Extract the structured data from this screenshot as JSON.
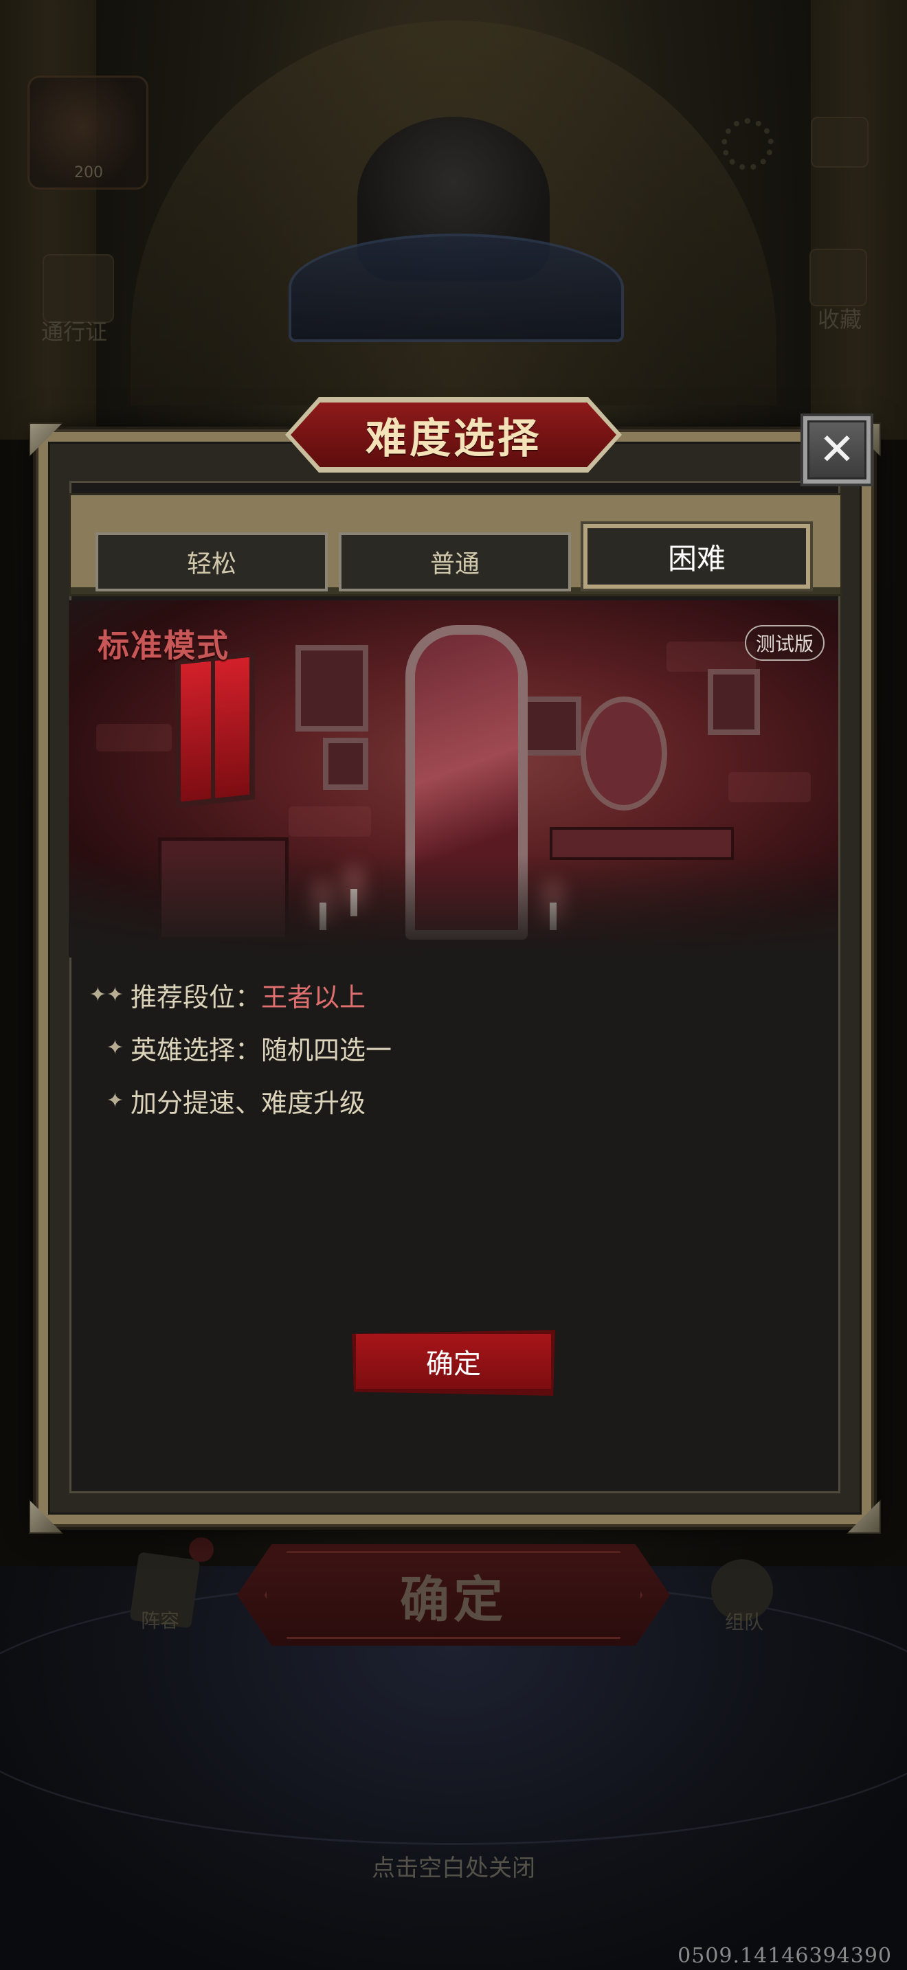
{
  "background": {
    "avatar_level": "200",
    "pass_label": "通行证",
    "collect_label": "收藏",
    "lineup_label": "阵容",
    "team_label": "组队",
    "big_confirm_label": "确定",
    "close_hint": "点击空白处关闭",
    "version": "0509.14146394390"
  },
  "dialog": {
    "title": "难度选择",
    "tabs": [
      {
        "label": "轻松",
        "active": false
      },
      {
        "label": "普通",
        "active": false
      },
      {
        "label": "困难",
        "active": true
      }
    ],
    "mode_title": "标准模式",
    "beta_badge": "测试版",
    "info": [
      {
        "prefix": "推荐段位：",
        "value": "王者以上",
        "highlight": true
      },
      {
        "prefix": "英雄选择：",
        "value": "随机四选一",
        "highlight": false
      },
      {
        "prefix": "加分提速、难度升级",
        "value": "",
        "highlight": false
      }
    ],
    "confirm_label": "确定"
  },
  "colors": {
    "accent_red": "#a71519",
    "highlight_text": "#e07070",
    "frame_tan": "#8a7c5a"
  },
  "icons": [
    "close-icon",
    "star-icon",
    "gear-icon",
    "avatar"
  ]
}
